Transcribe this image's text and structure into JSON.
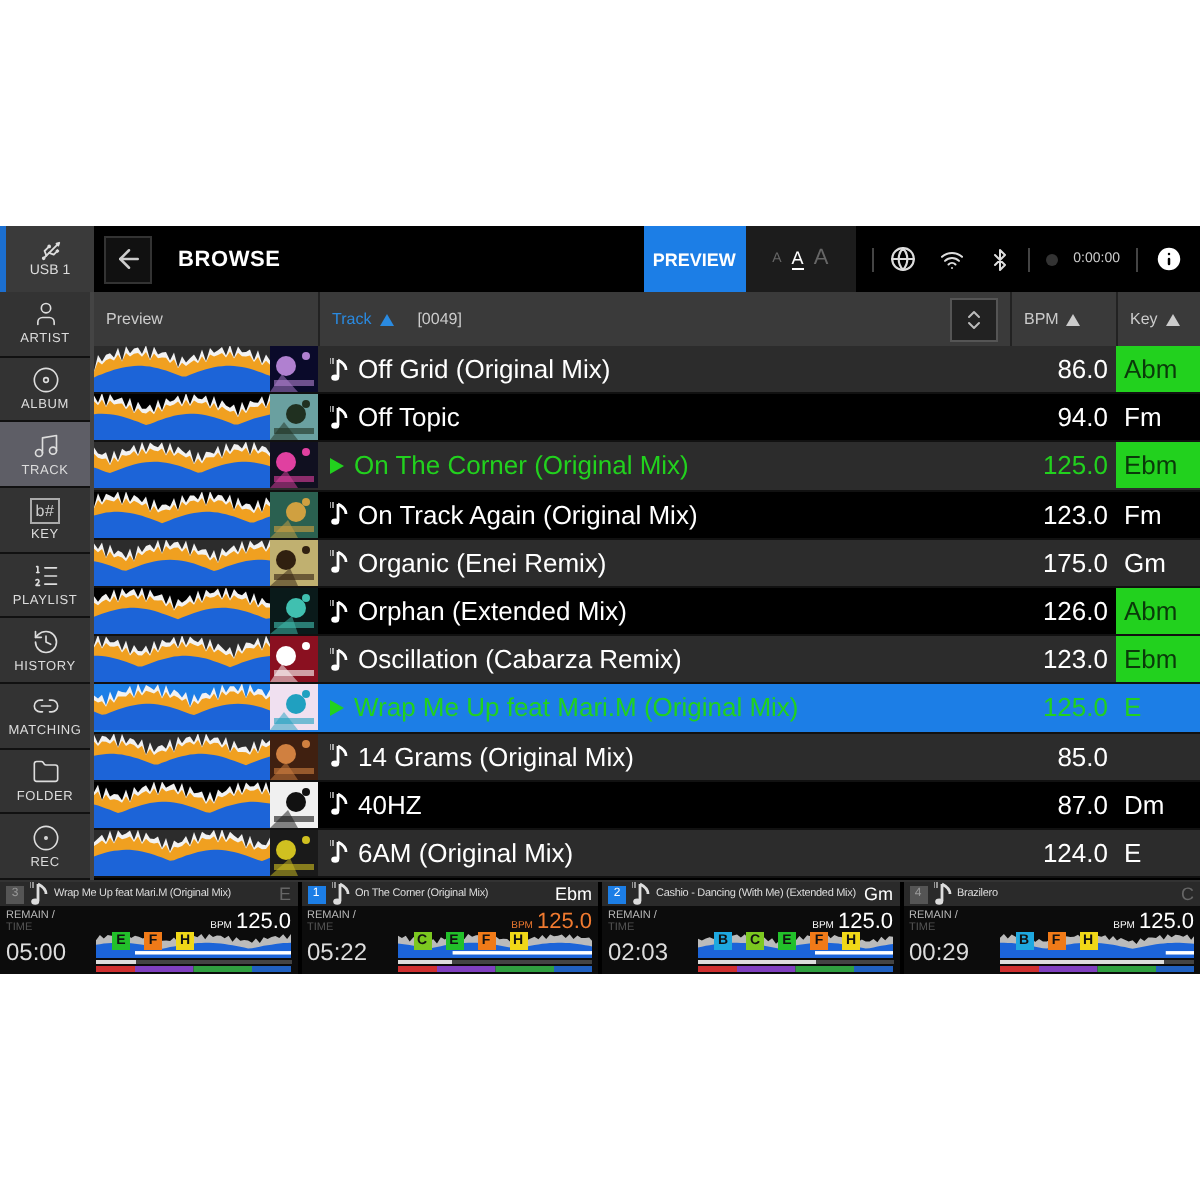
{
  "top_bar": {
    "source": "USB 1",
    "title": "BROWSE",
    "preview_button": "PREVIEW",
    "font_sizes": [
      {
        "label": "A",
        "selected": false
      },
      {
        "label": "A",
        "selected": true
      },
      {
        "label": "A",
        "selected": false
      }
    ],
    "time": "0:00:00"
  },
  "sidebar": [
    {
      "label": "ARTIST",
      "kind": "artist",
      "selected": false
    },
    {
      "label": "ALBUM",
      "kind": "album",
      "selected": false
    },
    {
      "label": "TRACK",
      "kind": "track",
      "selected": true
    },
    {
      "label": "KEY",
      "kind": "key",
      "glyph": "b#",
      "selected": false
    },
    {
      "label": "PLAYLIST",
      "kind": "playlist",
      "selected": false
    },
    {
      "label": "HISTORY",
      "kind": "history",
      "selected": false
    },
    {
      "label": "MATCHING",
      "kind": "matching",
      "selected": false
    },
    {
      "label": "FOLDER",
      "kind": "folder",
      "selected": false
    },
    {
      "label": "REC",
      "kind": "rec",
      "selected": false
    }
  ],
  "table": {
    "columns": {
      "preview": "Preview",
      "track": "Track",
      "count": "[0049]",
      "bpm": "BPM",
      "key": "Key"
    },
    "rows": [
      {
        "title": "Off Grid (Original Mix)",
        "bpm": "86.0",
        "key": "Abm",
        "key_match": true,
        "loaded": false,
        "selected": false
      },
      {
        "title": "Off Topic",
        "bpm": "94.0",
        "key": "Fm",
        "key_match": false,
        "loaded": false,
        "selected": false
      },
      {
        "title": "On The Corner (Original Mix)",
        "bpm": "125.0",
        "key": "Ebm",
        "key_match": true,
        "loaded": true,
        "selected": false
      },
      {
        "title": "On Track Again (Original Mix)",
        "bpm": "123.0",
        "key": "Fm",
        "key_match": false,
        "loaded": false,
        "selected": false
      },
      {
        "title": "Organic (Enei Remix)",
        "bpm": "175.0",
        "key": "Gm",
        "key_match": false,
        "loaded": false,
        "selected": false
      },
      {
        "title": "Orphan (Extended Mix)",
        "bpm": "126.0",
        "key": "Abm",
        "key_match": true,
        "loaded": false,
        "selected": false
      },
      {
        "title": "Oscillation (Cabarza Remix)",
        "bpm": "123.0",
        "key": "Ebm",
        "key_match": true,
        "loaded": false,
        "selected": false
      },
      {
        "title": "Wrap Me Up feat Mari.M (Original Mix)",
        "bpm": "125.0",
        "key": "E",
        "key_match": false,
        "loaded": true,
        "selected": true
      },
      {
        "title": "14 Grams (Original Mix)",
        "bpm": "85.0",
        "key_match": false,
        "loaded": false,
        "selected": false
      },
      {
        "title": "40HZ",
        "bpm": "87.0",
        "key": "Dm",
        "key_match": false,
        "loaded": false,
        "selected": false
      },
      {
        "title": "6AM (Original Mix)",
        "bpm": "124.0",
        "key": "E",
        "key_match": false,
        "loaded": false,
        "selected": false
      }
    ]
  },
  "decks": [
    {
      "number": "3",
      "active": false,
      "title": "Wrap Me Up feat Mari.M (Original Mix)",
      "key": "E",
      "remain_label": "REMAIN /",
      "time_label": "TIME",
      "time": "05:00",
      "bpm_label": "BPM",
      "bpm": "125.0",
      "master": false,
      "level": 0.2,
      "cues": [
        {
          "label": "E",
          "color": "#22c02a"
        },
        {
          "label": "F",
          "color": "#f07a18"
        },
        {
          "label": "H",
          "color": "#f0d818"
        }
      ]
    },
    {
      "number": "1",
      "active": true,
      "title": "On The Corner (Original Mix)",
      "key": "Ebm",
      "remain_label": "REMAIN /",
      "time_label": "TIME",
      "time": "05:22",
      "bpm_label": "BPM",
      "bpm": "125.0",
      "master": true,
      "level": 0.28,
      "cues": [
        {
          "label": "C",
          "color": "#7cc820"
        },
        {
          "label": "E",
          "color": "#22c02a"
        },
        {
          "label": "F",
          "color": "#f07a18"
        },
        {
          "label": "H",
          "color": "#f0d818"
        }
      ]
    },
    {
      "number": "2",
      "active": true,
      "title": "Cashio - Dancing (With Me) (Extended Mix)",
      "key": "Gm",
      "remain_label": "REMAIN /",
      "time_label": "TIME",
      "time": "02:03",
      "bpm_label": "BPM",
      "bpm": "125.0",
      "master": false,
      "level": 0.6,
      "cues": [
        {
          "label": "B",
          "color": "#1ea8e0"
        },
        {
          "label": "C",
          "color": "#7cc820"
        },
        {
          "label": "E",
          "color": "#22c02a"
        },
        {
          "label": "F",
          "color": "#f07a18"
        },
        {
          "label": "H",
          "color": "#f0d818"
        }
      ]
    },
    {
      "number": "4",
      "active": false,
      "title": "Brazilero",
      "key": "C",
      "remain_label": "REMAIN /",
      "time_label": "TIME",
      "time": "00:29",
      "bpm_label": "BPM",
      "bpm": "125.0",
      "master": false,
      "level": 0.85,
      "cues": [
        {
          "label": "B",
          "color": "#1ea8e0"
        },
        {
          "label": "F",
          "color": "#f07a18"
        },
        {
          "label": "H",
          "color": "#f0d818"
        }
      ]
    }
  ]
}
